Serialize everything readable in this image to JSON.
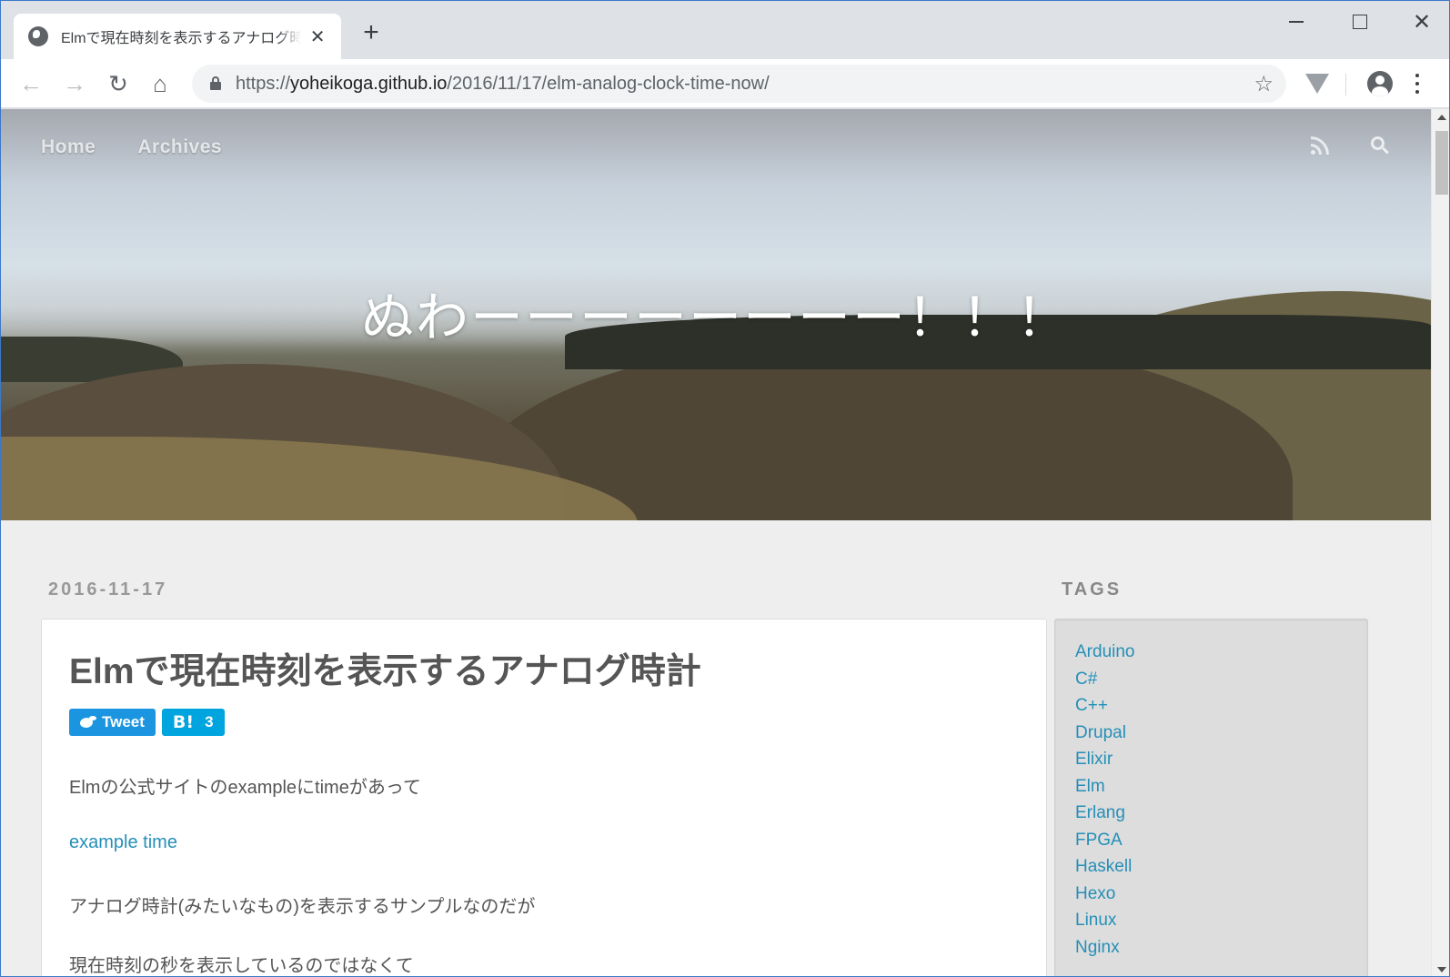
{
  "browser": {
    "tab": {
      "title": "Elmで現在時刻を表示するアナログ時計",
      "close_glyph": "✕"
    },
    "new_tab_glyph": "+",
    "window_close_glyph": "✕",
    "nav": {
      "back_glyph": "←",
      "forward_glyph": "→",
      "reload_glyph": "↻",
      "home_glyph": "⌂"
    },
    "url": {
      "scheme": "https://",
      "host": "yoheikoga.github.io",
      "path": "/2016/11/17/elm-analog-clock-time-now/"
    },
    "star_glyph": "☆"
  },
  "blog": {
    "nav": [
      {
        "label": "Home"
      },
      {
        "label": "Archives"
      }
    ],
    "site_title": "ぬわーーーーーーーー！！！"
  },
  "post": {
    "date": "2016-11-17",
    "title": "Elmで現在時刻を表示するアナログ時計",
    "tweet_label": "Tweet",
    "hatena_logo": "B!",
    "hatena_count": "3",
    "paragraphs": [
      "Elmの公式サイトのexampleにtimeがあって",
      "example time",
      "アナログ時計(みたいなもの)を表示するサンプルなのだが",
      "現在時刻の秒を表示しているのではなくて"
    ]
  },
  "sidebar": {
    "tags_heading": "TAGS",
    "tags": [
      "Arduino",
      "C#",
      "C++",
      "Drupal",
      "Elixir",
      "Elm",
      "Erlang",
      "FPGA",
      "Haskell",
      "Hexo",
      "Linux",
      "Nginx"
    ]
  }
}
